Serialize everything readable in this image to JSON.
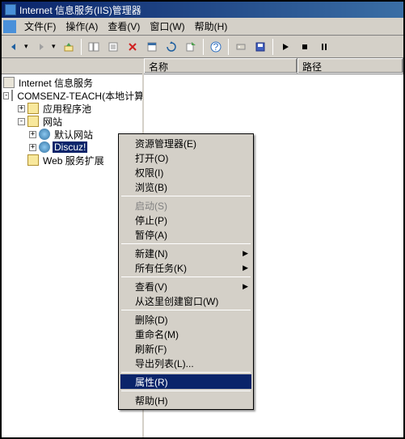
{
  "window": {
    "title": "Internet 信息服务(IIS)管理器"
  },
  "menubar": {
    "file": "文件(F)",
    "action": "操作(A)",
    "view": "查看(V)",
    "window": "窗口(W)",
    "help": "帮助(H)"
  },
  "tree": {
    "root": "Internet 信息服务",
    "computer": "COMSENZ-TEACH(本地计算",
    "app_pool": "应用程序池",
    "websites": "网站",
    "default_site": "默认网站",
    "discuz": "Discuz!",
    "web_ext": "Web 服务扩展"
  },
  "list_columns": {
    "name": "名称",
    "path": "路径"
  },
  "context_menu": {
    "explorer": "资源管理器(E)",
    "open": "打开(O)",
    "permissions": "权限(I)",
    "browse": "浏览(B)",
    "start": "启动(S)",
    "stop": "停止(P)",
    "pause": "暂停(A)",
    "new": "新建(N)",
    "all_tasks": "所有任务(K)",
    "view": "查看(V)",
    "new_window": "从这里创建窗口(W)",
    "delete": "删除(D)",
    "rename": "重命名(M)",
    "refresh": "刷新(F)",
    "export_list": "导出列表(L)...",
    "properties": "属性(R)",
    "help": "帮助(H)"
  }
}
